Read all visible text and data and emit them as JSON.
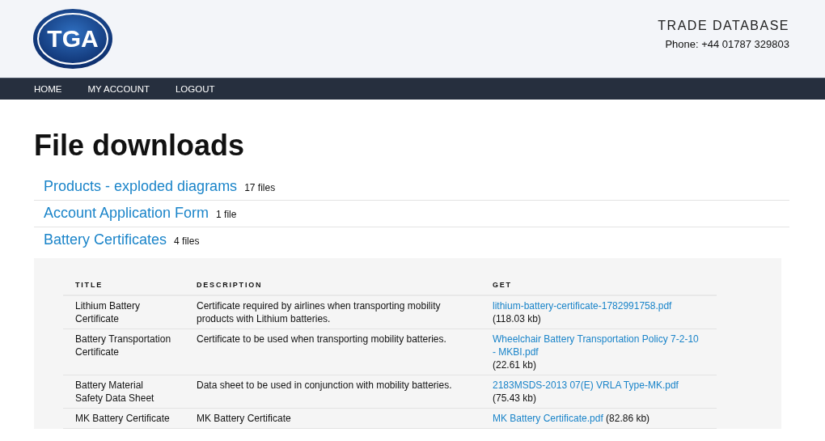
{
  "header": {
    "logo_text": "TGA",
    "site_title": "TRADE DATABASE",
    "phone": "Phone: +44 01787 329803"
  },
  "nav": [
    "HOME",
    "MY ACCOUNT",
    "LOGOUT"
  ],
  "page_title": "File downloads",
  "categories": [
    {
      "name": "Products - exploded diagrams",
      "count": "17 files"
    },
    {
      "name": "Account Application Form",
      "count": "1 file"
    },
    {
      "name": "Battery Certificates",
      "count": "4 files",
      "table": {
        "columns": [
          "TITLE",
          "DESCRIPTION",
          "GET"
        ],
        "rows": [
          {
            "title": "Lithium Battery Certificate",
            "description": "Certificate required by airlines when transporting mobility products with Lithium batteries.",
            "get": {
              "file": "lithium-battery-certificate-1782991758.pdf",
              "size": "(118.03 kb)"
            }
          },
          {
            "title": "Battery Transportation Certificate",
            "description": "Certificate to be used when transporting mobility batteries.",
            "get": {
              "file": "Wheelchair Battery Transportation Policy 7-2-10 - MKBI.pdf",
              "size": "(22.61 kb)"
            }
          },
          {
            "title": "Battery Material Safety Data Sheet",
            "description": "Data sheet to be used in conjunction with mobility batteries.",
            "get": {
              "file": "2183MSDS-2013 07(E) VRLA Type-MK.pdf",
              "size": "(75.43 kb)"
            }
          },
          {
            "title": "MK Battery Certificate",
            "description": "MK Battery Certificate",
            "get": {
              "file": "MK Battery Certificate.pdf",
              "size": "(82.86 kb)"
            }
          }
        ]
      }
    }
  ]
}
